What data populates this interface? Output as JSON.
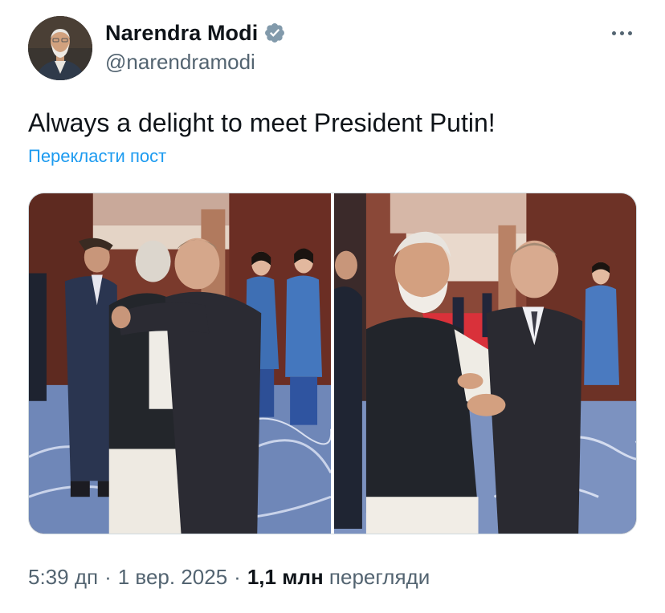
{
  "author": {
    "display_name": "Narendra Modi",
    "handle": "@narendramodi",
    "verified": true,
    "verified_color": "#829aab"
  },
  "tweet": {
    "text": "Always a delight to meet President Putin!",
    "translate_label": "Перекласти пост"
  },
  "media": {
    "count": 2
  },
  "meta": {
    "time": "5:39 дп",
    "separator": "·",
    "date": "1 вер. 2025",
    "views_count": "1,1 млн",
    "views_label": "перегляди"
  },
  "icons": {
    "more": "more-horizontal-icon",
    "verified": "verified-badge-icon"
  },
  "colors": {
    "text_primary": "#0f1419",
    "text_secondary": "#536471",
    "link": "#1d9bf0"
  }
}
